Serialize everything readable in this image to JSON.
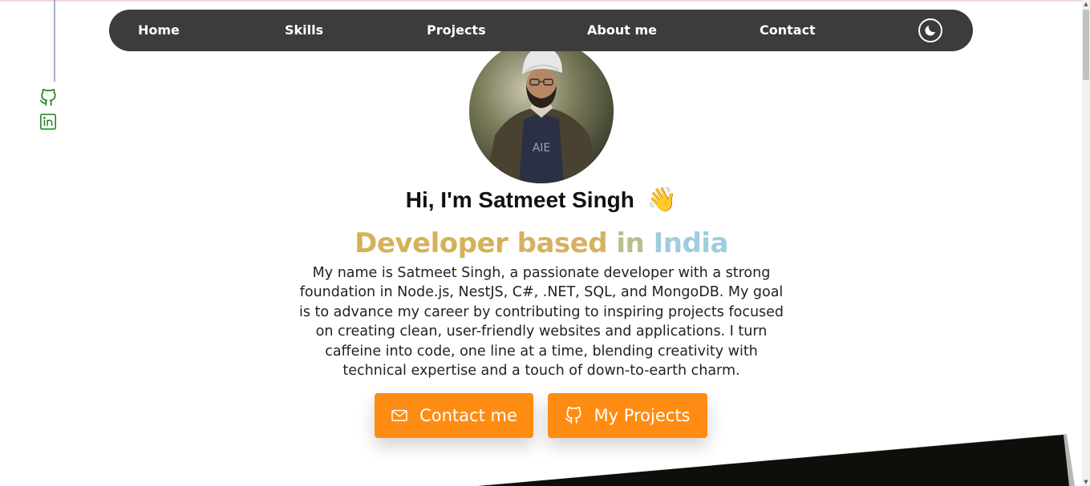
{
  "nav": {
    "items": [
      {
        "label": "Home"
      },
      {
        "label": "Skills"
      },
      {
        "label": "Projects"
      },
      {
        "label": "About me"
      },
      {
        "label": "Contact"
      }
    ],
    "theme_toggle_icon": "moon-icon",
    "background": "#3c3c3c"
  },
  "social": {
    "github_icon": "github-icon",
    "linkedin_icon": "linkedin-icon",
    "icon_color": "#2b8a2b"
  },
  "hero": {
    "greeting": "Hi, I'm Satmeet Singh",
    "wave": "👋",
    "role_words": [
      "Developer",
      "based",
      "in",
      "India"
    ],
    "role_colors": [
      "#d4b15a",
      "#d6b161",
      "#b4c18d",
      "#9fcde0"
    ],
    "bio": "My name is Satmeet Singh, a passionate developer with a strong foundation in Node.js, NestJS, C#, .NET, SQL, and MongoDB. My goal is to advance my career by contributing to inspiring projects focused on creating clean, user-friendly websites and applications. I turn caffeine into code, one line at a time, blending creativity with technical expertise and a touch of down-to-earth charm."
  },
  "buttons": {
    "contact_label": "Contact me",
    "contact_icon": "mail-icon",
    "projects_label": "My Projects",
    "projects_icon": "github-icon",
    "color": "#ff8c12"
  }
}
